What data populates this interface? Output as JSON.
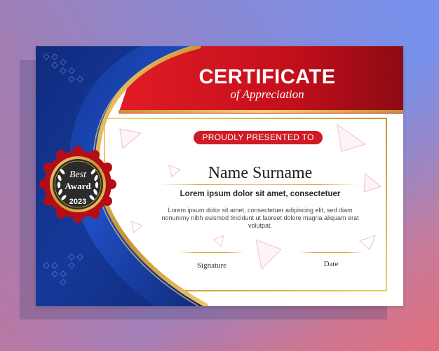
{
  "certificate": {
    "title": "CERTIFICATE",
    "subtitle": "of Appreciation",
    "presented_to": "PROUDLY PRESENTED TO",
    "recipient_name": "Name Surname",
    "headline": "Lorem ipsum dolor sit amet, consectetuer",
    "body_text": "Lorem ipsum dolor sit amet, consectetuer adipiscing elit, sed diam nonummy nibh euismod tincidunt ut laoreet dolore magna aliquam erat volutpat.",
    "signature_label": "Signature",
    "date_label": "Date"
  },
  "award_badge": {
    "line1": "Best",
    "line2": "Award",
    "year": "2023"
  },
  "colors": {
    "navy": "#15338f",
    "royal_blue": "#1f4fc4",
    "red": "#c8101e",
    "dark_red": "#8f0a12",
    "gold": "#d6a83e",
    "badge_dark": "#2b2b2b"
  }
}
